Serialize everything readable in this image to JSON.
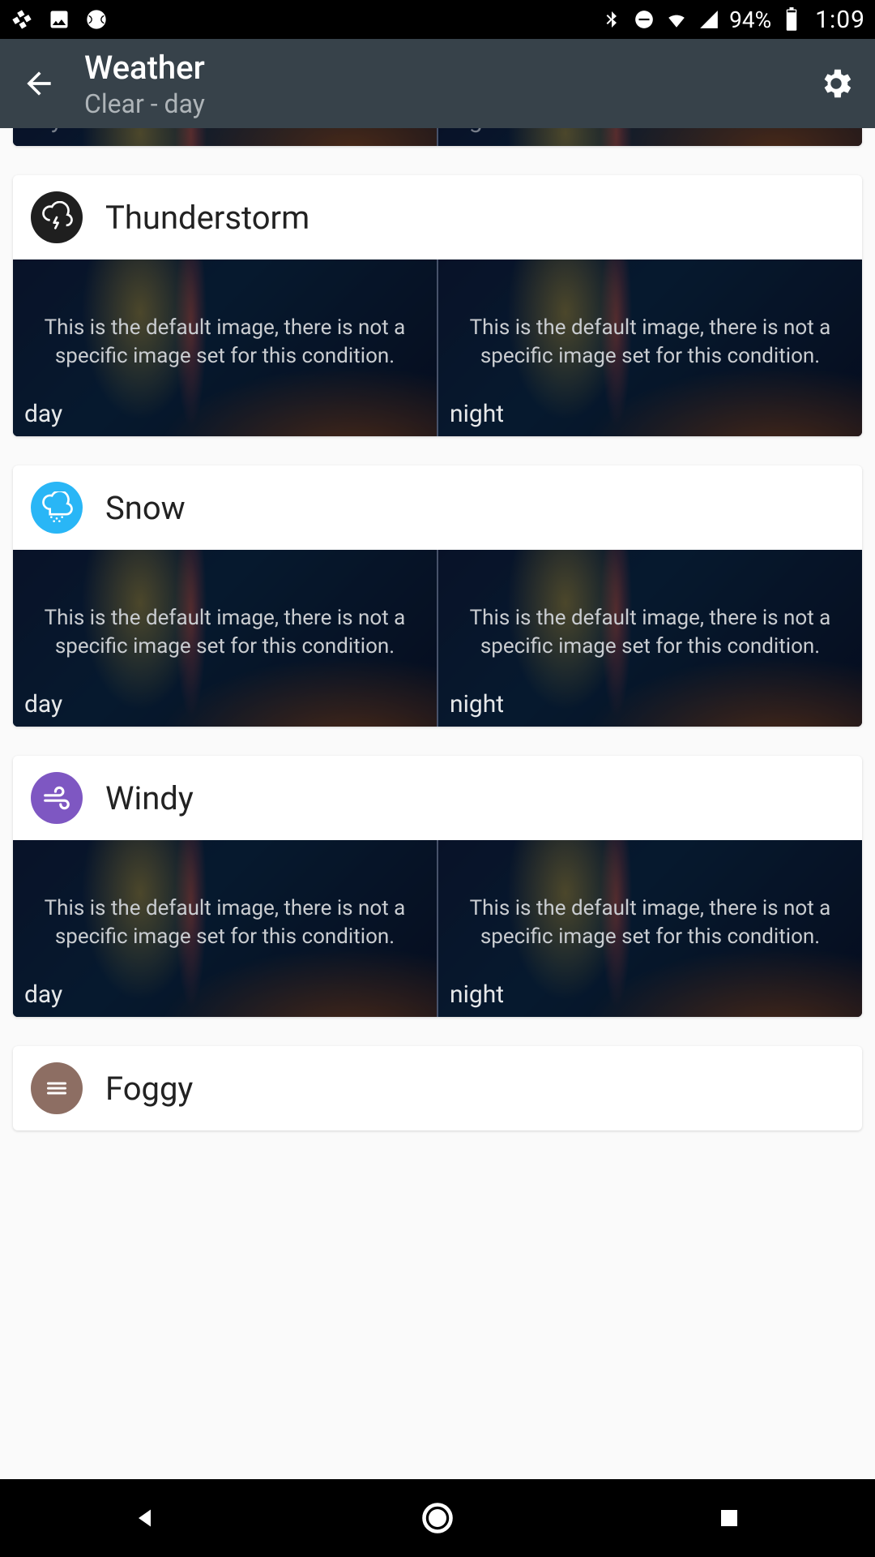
{
  "status": {
    "battery": "94%",
    "time": "1:09"
  },
  "appbar": {
    "title": "Weather",
    "subtitle": "Clear - day"
  },
  "labels": {
    "day": "day",
    "night": "night"
  },
  "default_msg": "This is the default image, there is not a specific image set for this condition.",
  "conditions": [
    {
      "name": "Thunderstorm",
      "icon_bg": "#1f1f1f",
      "icon": "thunder"
    },
    {
      "name": "Snow",
      "icon_bg": "#29b6f6",
      "icon": "snow"
    },
    {
      "name": "Windy",
      "icon_bg": "#7e57c2",
      "icon": "wind"
    },
    {
      "name": "Foggy",
      "icon_bg": "#8d6e63",
      "icon": "fog"
    }
  ]
}
